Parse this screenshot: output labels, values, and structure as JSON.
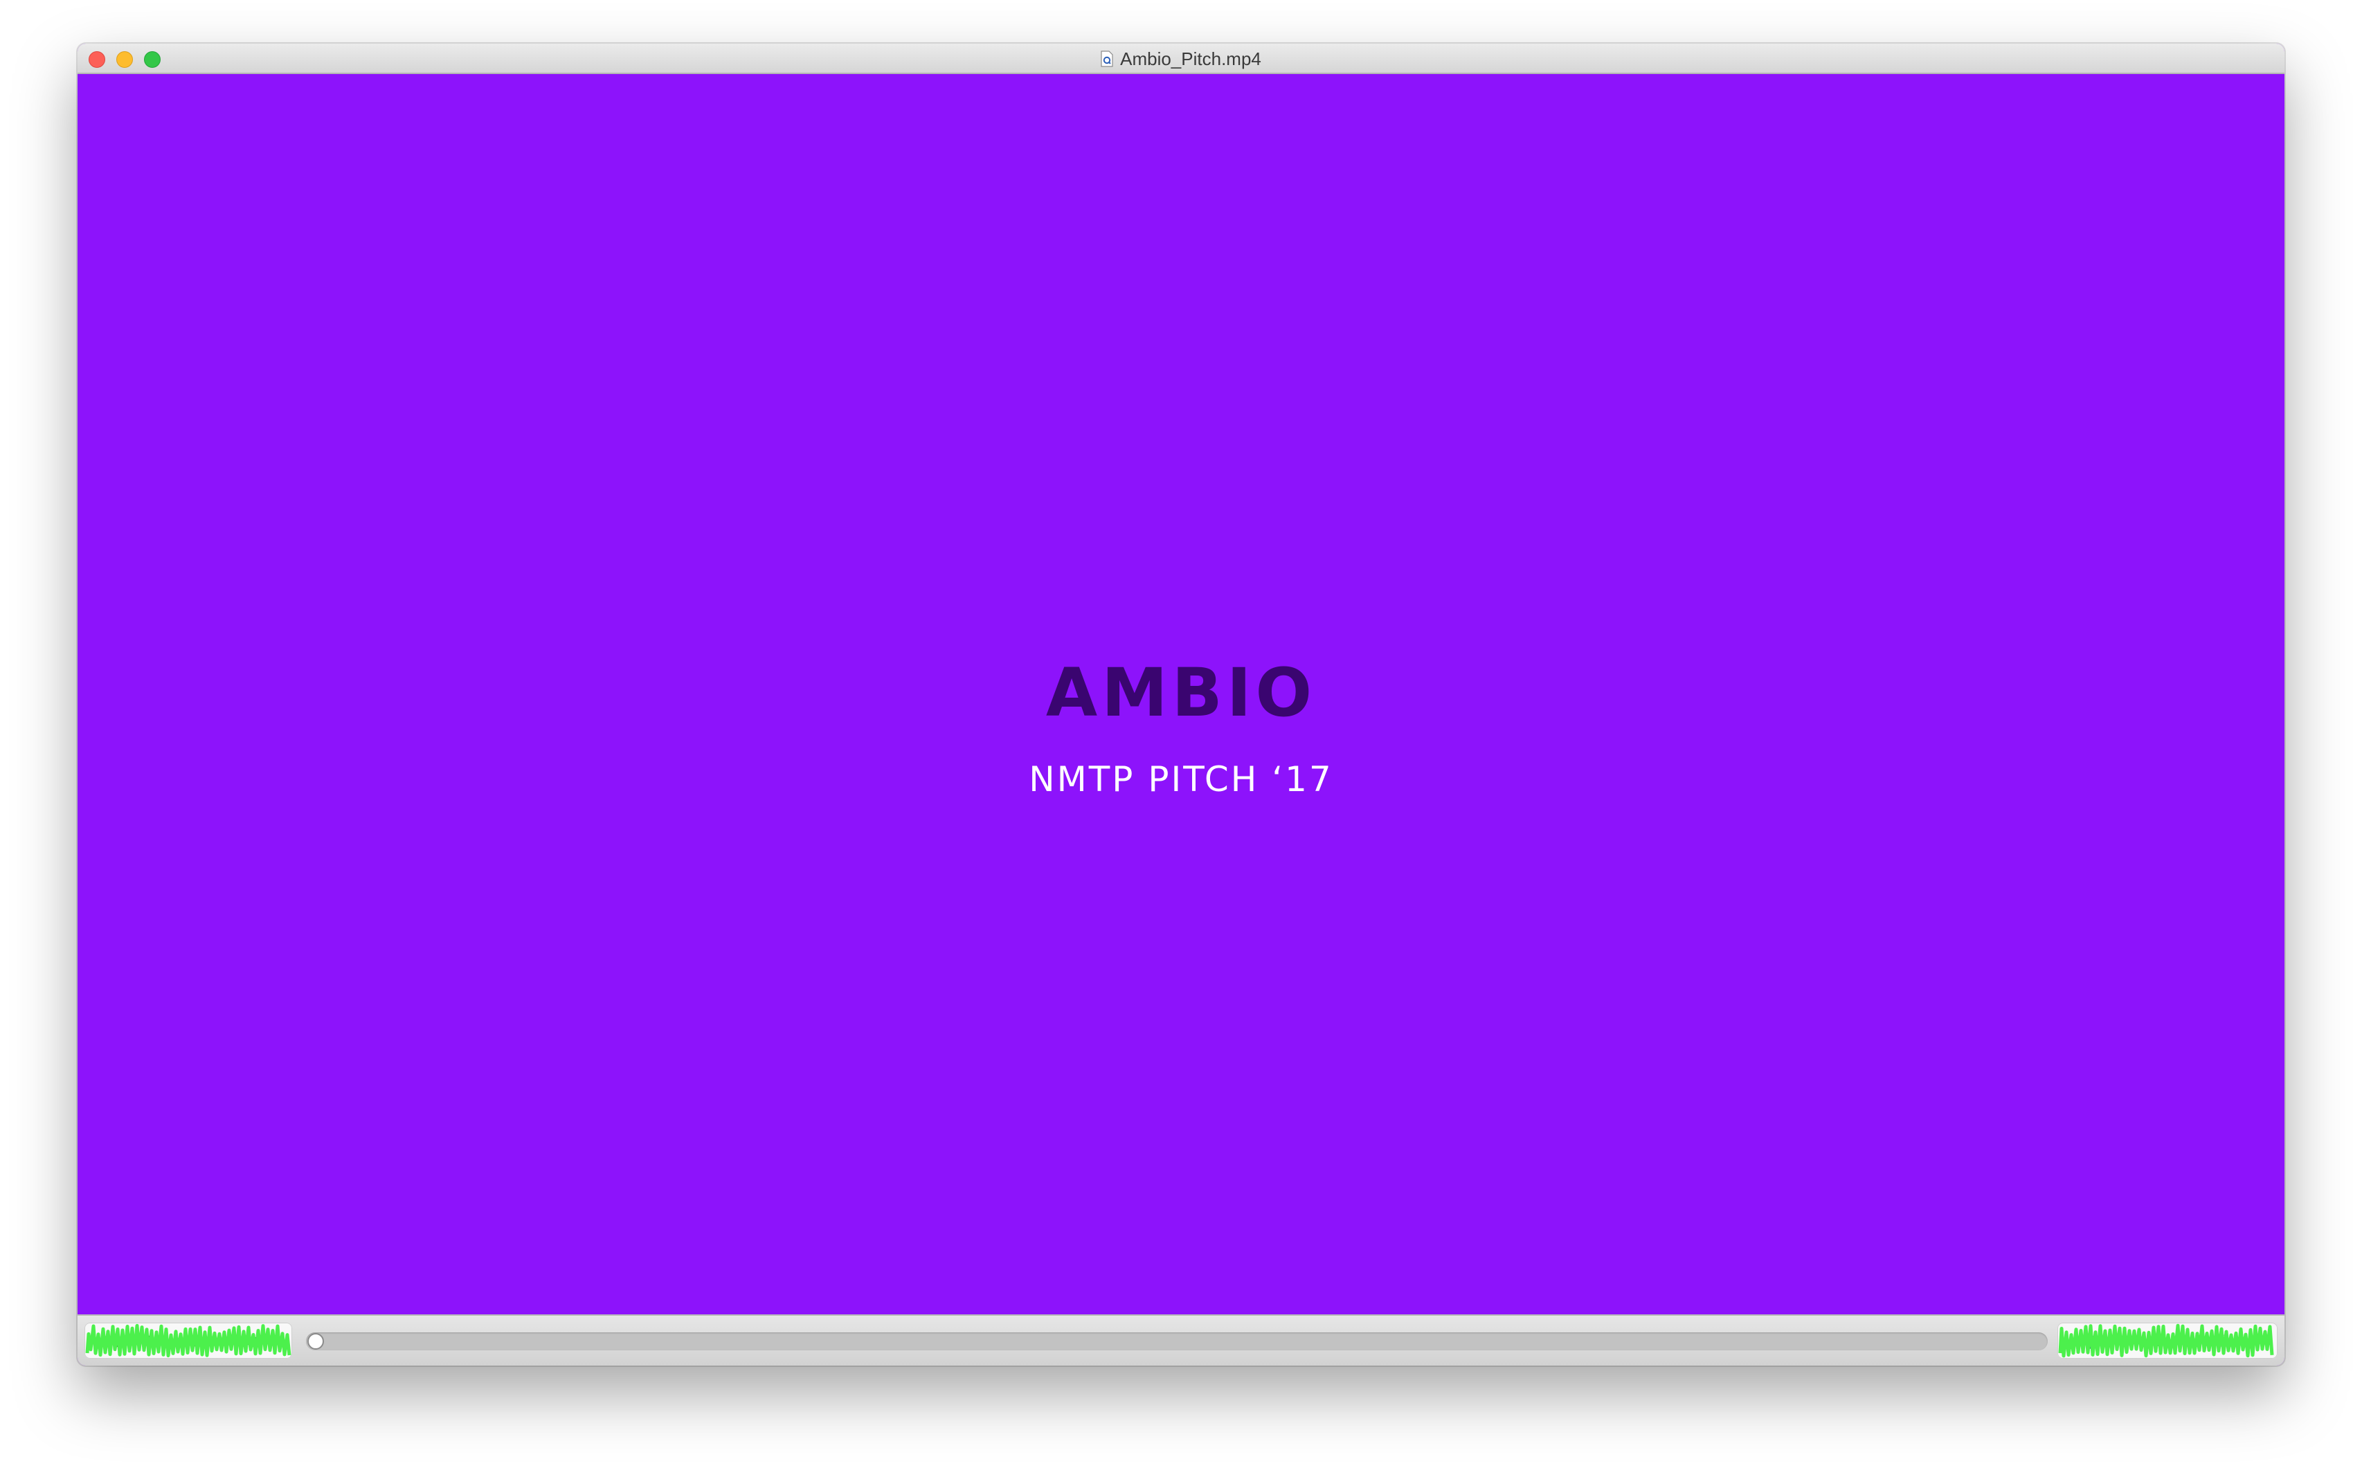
{
  "window": {
    "title": "Ambio_Pitch.mp4",
    "file_icon": "quicktime-file-icon"
  },
  "video": {
    "background_color": "#8d13fb",
    "slide_title": "AMBIO",
    "slide_title_color": "#3a0570",
    "slide_subtitle": "NMTP PITCH ‘17",
    "slide_subtitle_color": "#ffffff"
  },
  "controls": {
    "left_buttons": [
      {
        "name": "rewind-button",
        "icon": "rewind-icon",
        "glyph": "◀◀"
      },
      {
        "name": "play-button",
        "icon": "play-icon",
        "glyph": "▶"
      },
      {
        "name": "fast-forward-button",
        "icon": "fast-forward-icon",
        "glyph": "▶▶"
      },
      {
        "name": "chapters-button",
        "icon": "list-icon",
        "glyph": "≡"
      }
    ],
    "right_buttons": [
      {
        "name": "volume-button",
        "icon": "speaker-icon",
        "glyph": "🔈"
      },
      {
        "name": "share-button",
        "icon": "share-icon",
        "glyph": "⇪"
      },
      {
        "name": "fullscreen-button",
        "icon": "expand-icon",
        "glyph": "⤢"
      }
    ],
    "playback_progress": 0.0,
    "redaction_color": "#4cf04c"
  }
}
